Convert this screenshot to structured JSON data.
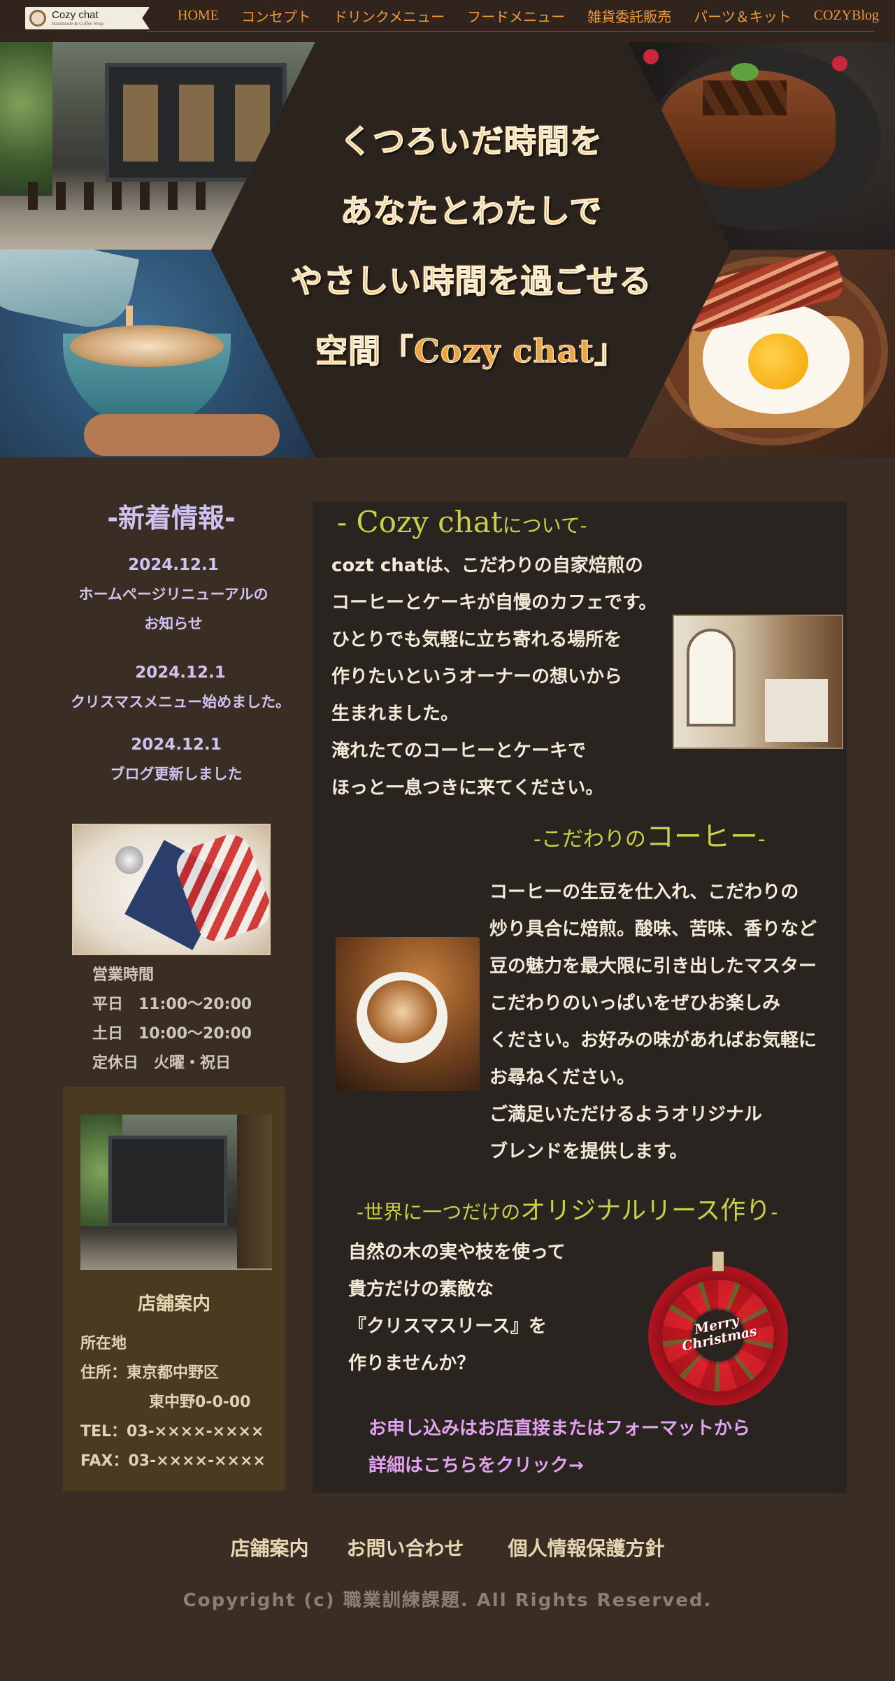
{
  "header": {
    "logo": {
      "name": "Cozy chat",
      "sub": "Handmade & Coffee Shop"
    },
    "nav": [
      "HOME",
      "コンセプト",
      "ドリンクメニュー",
      "フードメニュー",
      "雑貨委託販売",
      "パーツ＆キット",
      "COZYBlog"
    ]
  },
  "hero": {
    "lines": [
      "くつろいだ時間を",
      "あなたとわたしで",
      "やさしい時間を過ごせる",
      "空間「Cozy chat」"
    ]
  },
  "news": {
    "title": "-新着情報-",
    "items": [
      {
        "date": "2024.12.1",
        "text": "ホームページリニューアルの\nお知らせ"
      },
      {
        "date": "2024.12.1",
        "text": "クリスマスメニュー始めました。"
      },
      {
        "date": "2024.12.1",
        "text": "ブログ更新しました"
      }
    ]
  },
  "hours": {
    "title": "営業時間",
    "weekday": "平日　11:00～20:00",
    "saturday": "土日　10:00～20:00",
    "closed": "定休日　火曜・祝日"
  },
  "store": {
    "title": "店舗案内",
    "location_label": "所在地",
    "address1": "住所：東京都中野区",
    "address2": "東中野0-0-00",
    "tel": "TEL：03-××××-××××",
    "fax": "FAX：03-××××-××××"
  },
  "about": {
    "title_main": "- Cozy chat",
    "title_small": "について-",
    "lines": [
      "cozt chatは、こだわりの自家焙煎の",
      "コーヒーとケーキが自慢のカフェです。",
      "ひとりでも気軽に立ち寄れる場所を",
      "作りたいというオーナーの想いから",
      "生まれました。",
      "淹れたてのコーヒーとケーキで",
      "ほっと一息つきに来てください。"
    ]
  },
  "coffee": {
    "title_pre": "-こだわりの",
    "title_big": "コーヒー",
    "title_post": "-",
    "lines": [
      "コーヒーの生豆を仕入れ、こだわりの",
      "炒り具合に焙煎。酸味、苦味、香りなど",
      "豆の魅力を最大限に引き出したマスター",
      "こだわりのいっぱいをぜひお楽しみ",
      "ください。お好みの味があればお気軽に",
      "お尋ねください。",
      "ご満足いただけるようオリジナル",
      "ブレンドを提供します。"
    ]
  },
  "wreath": {
    "title_pre": "-世界に一つだけの",
    "title_big": "オリジナルリース作り",
    "title_post": "-",
    "lines": [
      "自然の木の実や枝を使って",
      "貴方だけの素敵な",
      "『クリスマスリース』を",
      "作りませんか？"
    ],
    "image_text": "Merry Christmas"
  },
  "apply": {
    "line1": "お申し込みはお店直接またはフォーマットから",
    "line2": "詳細はこちらをクリック→"
  },
  "footer": {
    "links": [
      "店舗案内",
      "お問い合わせ",
      "個人情報保護方針"
    ],
    "copyright": "Copyright (c) 職業訓練課題. All Rights Reserved."
  }
}
